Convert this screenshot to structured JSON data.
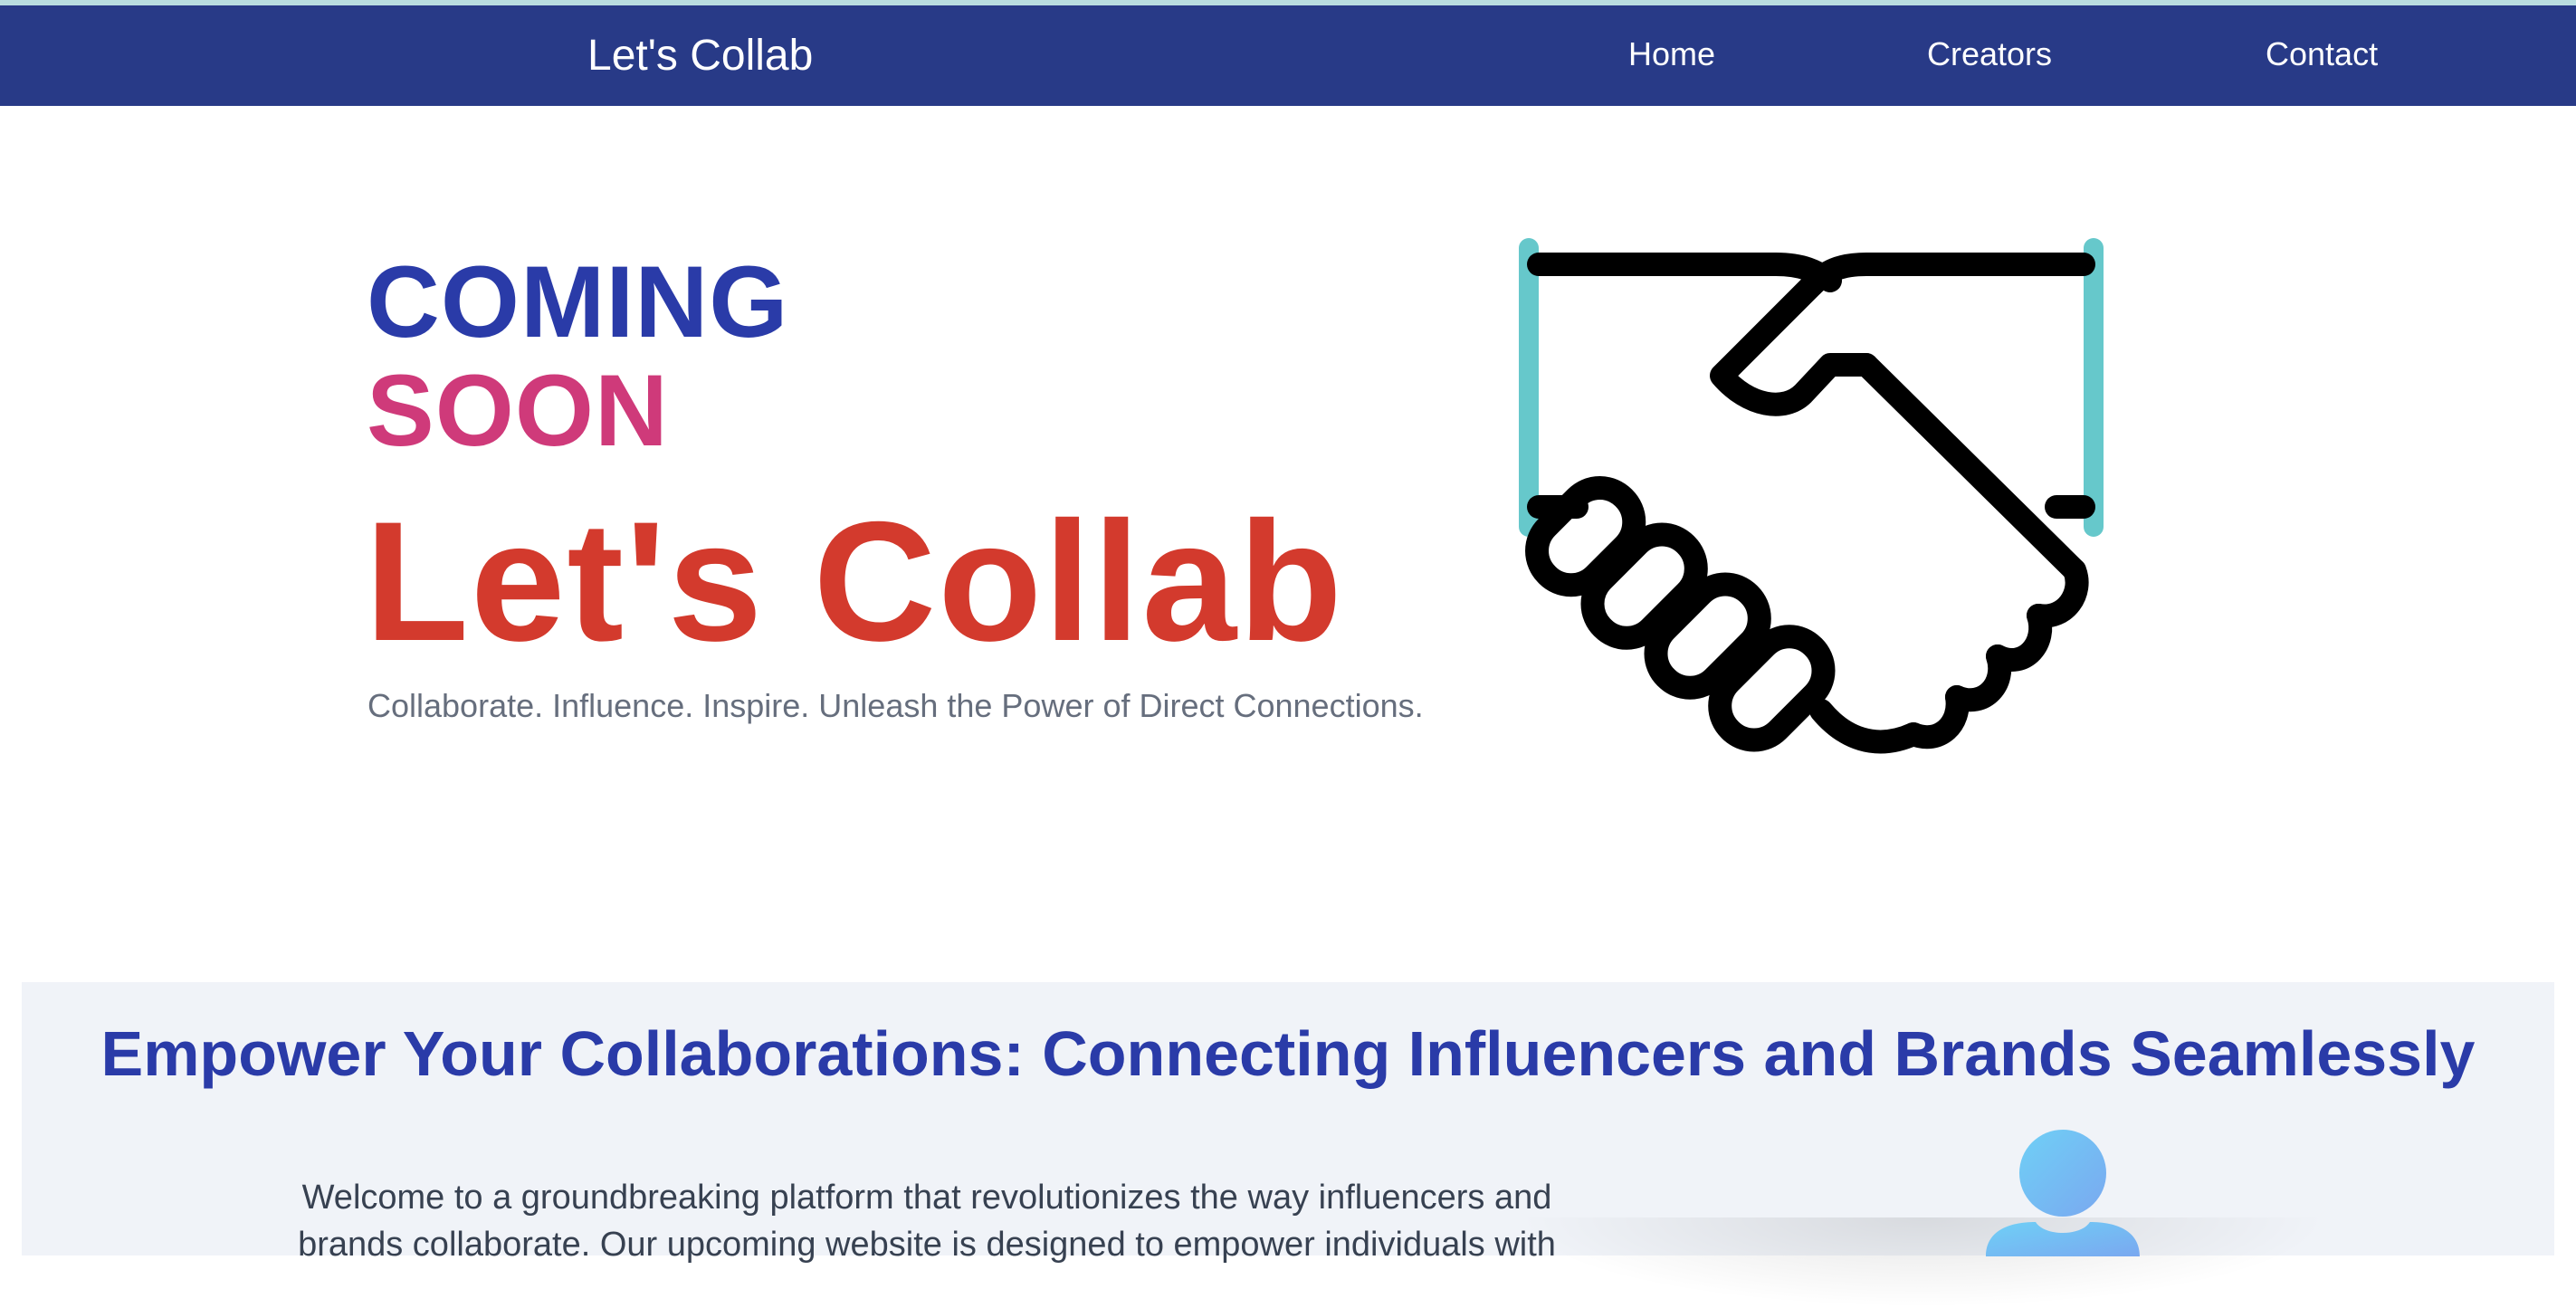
{
  "navbar": {
    "brand": "Let's Collab",
    "links": [
      {
        "label": "Home"
      },
      {
        "label": "Creators"
      },
      {
        "label": "Contact"
      }
    ],
    "background": "#283a87"
  },
  "hero": {
    "coming": "COMING",
    "soon": "SOON",
    "title": "Let's Collab",
    "tagline": "Collaborate. Influence. Inspire. Unleash the Power of Direct Connections.",
    "illustration": "handshake-icon",
    "colors": {
      "coming": "#2a3ba8",
      "soon": "#cf3a7a",
      "title": "#d33a2d",
      "accent": "#66c8cb"
    }
  },
  "features": {
    "heading": "Empower Your Collaborations: Connecting Influencers and Brands Seamlessly",
    "text": "Welcome to a groundbreaking platform that revolutionizes the way influencers and brands collaborate. Our upcoming website is designed to empower individuals with",
    "avatar_icon": "user-icon"
  }
}
